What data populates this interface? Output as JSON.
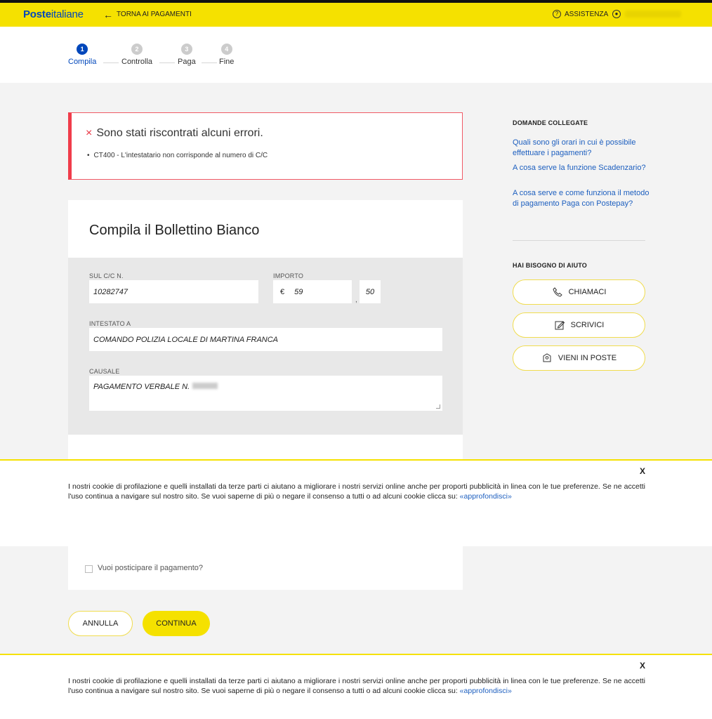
{
  "header": {
    "logo_bold": "Poste",
    "logo_regular": "italiane",
    "back_label": "TORNA AI PAGAMENTI",
    "assist_label": "ASSISTENZA"
  },
  "stepper": {
    "steps": [
      {
        "num": "1",
        "label": "Compila"
      },
      {
        "num": "2",
        "label": "Controlla"
      },
      {
        "num": "3",
        "label": "Paga"
      },
      {
        "num": "4",
        "label": "Fine"
      }
    ]
  },
  "error": {
    "title": "Sono stati riscontrati alcuni errori.",
    "item": "CT400 - L'intestatario non corrisponde al numero di C/C"
  },
  "form": {
    "title": "Compila il Bollettino Bianco",
    "cc_label": "SUL C/C N.",
    "cc_value": "10282747",
    "importo_label": "IMPORTO",
    "currency": "€",
    "importo_int": "59",
    "importo_dec": "50",
    "intestato_label": "INTESTATO A",
    "intestato_value": "COMANDO POLIZIA LOCALE DI MARTINA FRANCA",
    "causale_label": "CAUSALE",
    "causale_value": "PAGAMENTO VERBALE N."
  },
  "sidebar": {
    "questions_title": "DOMANDE COLLEGATE",
    "links": [
      "Quali sono gli orari in cui è possibile effettuare i pagamenti?",
      "A cosa serve la funzione Scadenzario?",
      "A cosa serve e come funziona il metodo di pagamento Paga con Postepay?"
    ],
    "help_title": "HAI BISOGNO DI AIUTO",
    "help_buttons": [
      "CHIAMACI",
      "SCRIVICI",
      "VIENI IN POSTE"
    ]
  },
  "cookie": {
    "close": "X",
    "text": "I nostri cookie di profilazione e quelli installati da terze parti ci aiutano a migliorare i nostri servizi online anche per proporti pubblicità in linea con le tue preferenze. Se ne accetti l'uso continua a navigare sul nostro sito. Se vuoi saperne di più o negare il consenso a tutti o ad alcuni cookie clicca su: ",
    "link": "«approfondisci»"
  },
  "postpone_label": "Vuoi posticipare il pagamento?",
  "actions": {
    "cancel": "ANNULLA",
    "continue": "CONTINUA"
  }
}
